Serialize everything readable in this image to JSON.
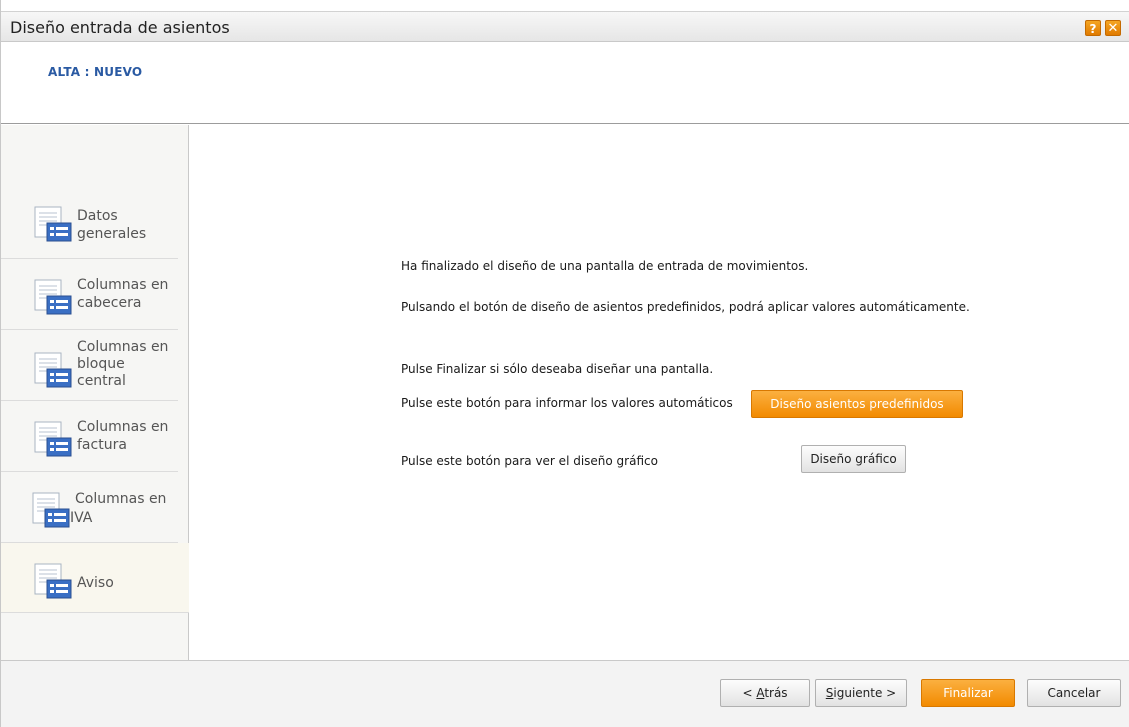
{
  "window": {
    "title": "Diseño entrada de asientos",
    "help_icon": "?",
    "close_icon": "✕"
  },
  "header": {
    "mode": "ALTA : NUEVO"
  },
  "sidebar": {
    "items": [
      {
        "line1": "Datos",
        "line2": "generales",
        "line3": ""
      },
      {
        "line1": "Columnas en",
        "line2": "cabecera",
        "line3": ""
      },
      {
        "line1": "Columnas en",
        "line2": "bloque",
        "line3": "central"
      },
      {
        "line1": "Columnas en",
        "line2": "factura",
        "line3": ""
      },
      {
        "line1": "Columnas en",
        "line2": "IVA",
        "line3": ""
      },
      {
        "line1": "Aviso",
        "line2": "",
        "line3": ""
      }
    ],
    "active_index": 5
  },
  "main": {
    "msg_finished": "Ha finalizado el diseño de una pantalla de entrada de movimientos.",
    "msg_predefined": "Pulsando el botón de diseño de asientos predefinidos, podrá aplicar valores automáticamente.",
    "msg_finalize": "Pulse Finalizar si sólo deseaba diseñar una pantalla.",
    "msg_auto_values": "Pulse este botón para informar los valores automáticos",
    "btn_predefined": "Diseño asientos predefinidos",
    "msg_graphic": "Pulse este botón para ver el diseño gráfico",
    "btn_graphic": "Diseño gráfico"
  },
  "footer": {
    "back_prefix": "< ",
    "back_accel": "A",
    "back_rest": "trás",
    "next_accel": "S",
    "next_rest": "iguiente >",
    "finish": "Finalizar",
    "cancel": "Cancelar"
  },
  "colors": {
    "accent_orange": "#f28a00",
    "header_blue": "#2a5aa3"
  }
}
